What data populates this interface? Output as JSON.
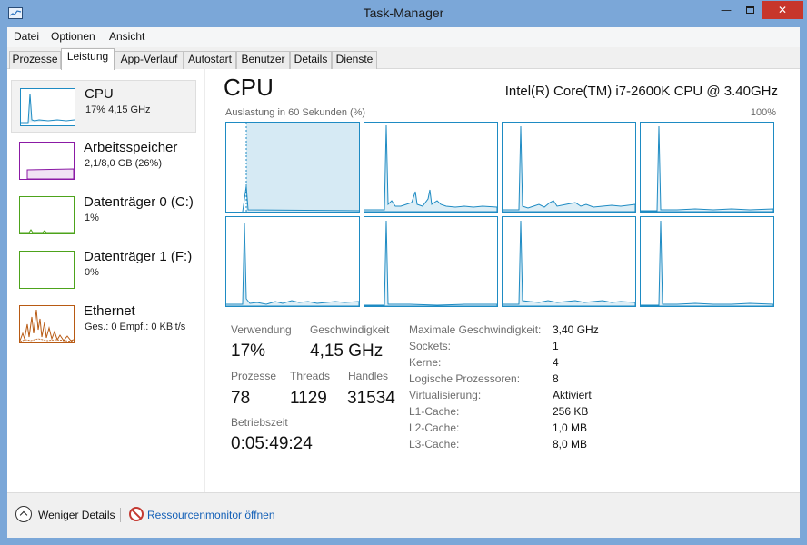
{
  "window": {
    "title": "Task-Manager"
  },
  "menu": [
    "Datei",
    "Optionen",
    "Ansicht"
  ],
  "tabs": [
    "Prozesse",
    "Leistung",
    "App-Verlauf",
    "Autostart",
    "Benutzer",
    "Details",
    "Dienste"
  ],
  "active_tab": "Leistung",
  "sidebar": [
    {
      "title": "CPU",
      "sub": "17% 4,15 GHz",
      "color": "#1e8bc3",
      "usage": 0.17
    },
    {
      "title": "Arbeitsspeicher",
      "sub": "2,1/8,0 GB (26%)",
      "color": "#8b1aa5",
      "usage": 0.26
    },
    {
      "title": "Datenträger 0 (C:)",
      "sub": "1%",
      "color": "#4da31b",
      "usage": 0.01
    },
    {
      "title": "Datenträger 1 (F:)",
      "sub": "0%",
      "color": "#4da31b",
      "usage": 0.0
    },
    {
      "title": "Ethernet",
      "sub_prefix_sent": "Ges.: ",
      "sub_sent": "0",
      "sub_prefix_recv": " Empf.: ",
      "sub_recv": "0 KBit/s",
      "color": "#b85a13"
    }
  ],
  "main": {
    "title": "CPU",
    "model": "Intel(R) Core(TM) i7-2600K CPU @ 3.40GHz",
    "graph_caption": "Auslastung in 60 Sekunden (%)",
    "graph_max": "100%",
    "accent_color": "#1e8bc3",
    "stats": {
      "usage_label": "Verwendung",
      "usage_value": "17%",
      "speed_label": "Geschwindigkeit",
      "speed_value": "4,15 GHz",
      "processes_label": "Prozesse",
      "processes_value": "78",
      "threads_label": "Threads",
      "threads_value": "1129",
      "handles_label": "Handles",
      "handles_value": "31534",
      "uptime_label": "Betriebszeit",
      "uptime_value": "0:05:49:24"
    },
    "details": [
      {
        "label": "Maximale Geschwindigkeit:",
        "value": "3,40 GHz"
      },
      {
        "label": "Sockets:",
        "value": "1"
      },
      {
        "label": "Kerne:",
        "value": "4"
      },
      {
        "label": "Logische Prozessoren:",
        "value": "8"
      },
      {
        "label": "Virtualisierung:",
        "value": "Aktiviert"
      },
      {
        "label": "L1-Cache:",
        "value": "256 KB"
      },
      {
        "label": "L2-Cache:",
        "value": "1,0 MB"
      },
      {
        "label": "L3-Cache:",
        "value": "8,0 MB"
      }
    ]
  },
  "footer": {
    "fewer_details": "Weniger Details",
    "resource_monitor": "Ressourcenmonitor öffnen"
  }
}
